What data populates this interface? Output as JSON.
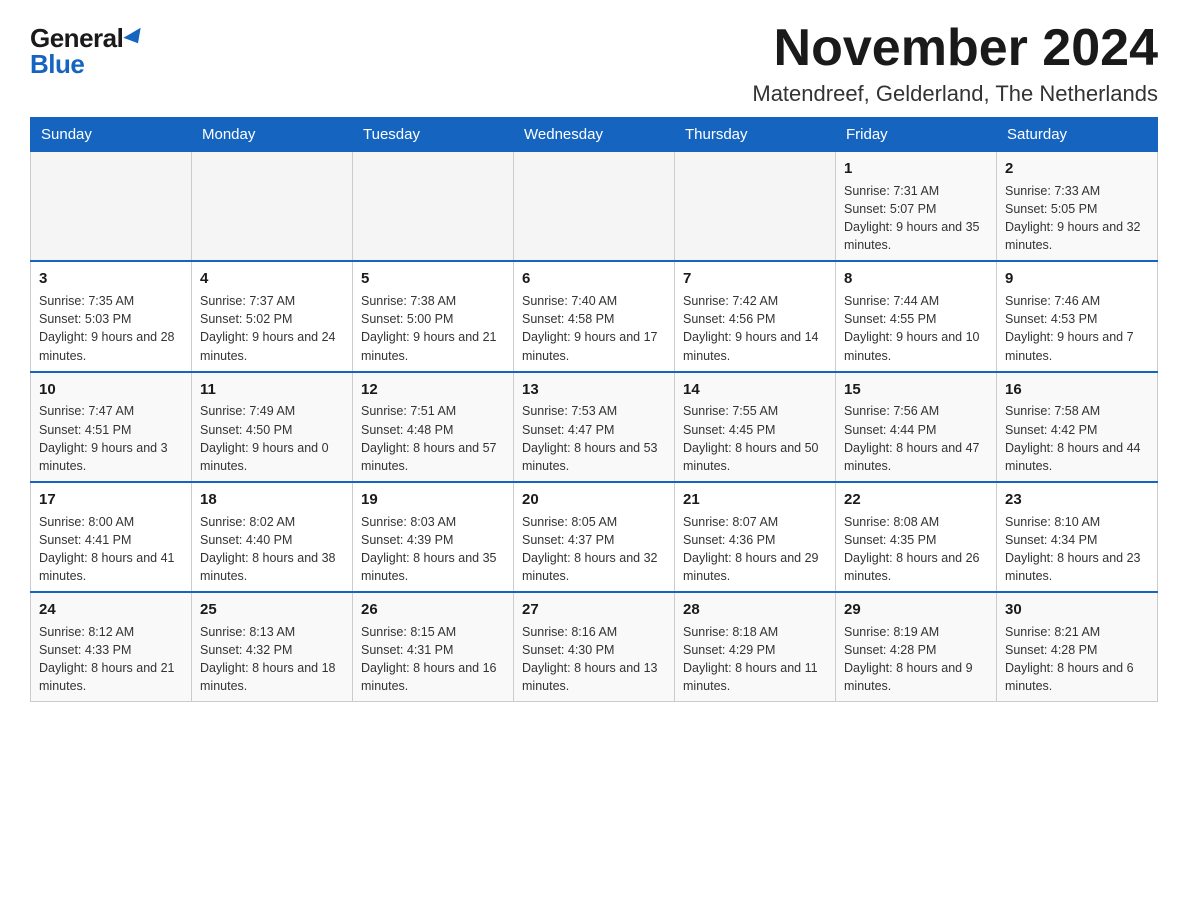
{
  "logo": {
    "general": "General",
    "blue": "Blue",
    "triangle": "▶"
  },
  "title": {
    "month_year": "November 2024",
    "location": "Matendreef, Gelderland, The Netherlands"
  },
  "headers": [
    "Sunday",
    "Monday",
    "Tuesday",
    "Wednesday",
    "Thursday",
    "Friday",
    "Saturday"
  ],
  "weeks": [
    [
      {
        "day": "",
        "info": ""
      },
      {
        "day": "",
        "info": ""
      },
      {
        "day": "",
        "info": ""
      },
      {
        "day": "",
        "info": ""
      },
      {
        "day": "",
        "info": ""
      },
      {
        "day": "1",
        "info": "Sunrise: 7:31 AM\nSunset: 5:07 PM\nDaylight: 9 hours and 35 minutes."
      },
      {
        "day": "2",
        "info": "Sunrise: 7:33 AM\nSunset: 5:05 PM\nDaylight: 9 hours and 32 minutes."
      }
    ],
    [
      {
        "day": "3",
        "info": "Sunrise: 7:35 AM\nSunset: 5:03 PM\nDaylight: 9 hours and 28 minutes."
      },
      {
        "day": "4",
        "info": "Sunrise: 7:37 AM\nSunset: 5:02 PM\nDaylight: 9 hours and 24 minutes."
      },
      {
        "day": "5",
        "info": "Sunrise: 7:38 AM\nSunset: 5:00 PM\nDaylight: 9 hours and 21 minutes."
      },
      {
        "day": "6",
        "info": "Sunrise: 7:40 AM\nSunset: 4:58 PM\nDaylight: 9 hours and 17 minutes."
      },
      {
        "day": "7",
        "info": "Sunrise: 7:42 AM\nSunset: 4:56 PM\nDaylight: 9 hours and 14 minutes."
      },
      {
        "day": "8",
        "info": "Sunrise: 7:44 AM\nSunset: 4:55 PM\nDaylight: 9 hours and 10 minutes."
      },
      {
        "day": "9",
        "info": "Sunrise: 7:46 AM\nSunset: 4:53 PM\nDaylight: 9 hours and 7 minutes."
      }
    ],
    [
      {
        "day": "10",
        "info": "Sunrise: 7:47 AM\nSunset: 4:51 PM\nDaylight: 9 hours and 3 minutes."
      },
      {
        "day": "11",
        "info": "Sunrise: 7:49 AM\nSunset: 4:50 PM\nDaylight: 9 hours and 0 minutes."
      },
      {
        "day": "12",
        "info": "Sunrise: 7:51 AM\nSunset: 4:48 PM\nDaylight: 8 hours and 57 minutes."
      },
      {
        "day": "13",
        "info": "Sunrise: 7:53 AM\nSunset: 4:47 PM\nDaylight: 8 hours and 53 minutes."
      },
      {
        "day": "14",
        "info": "Sunrise: 7:55 AM\nSunset: 4:45 PM\nDaylight: 8 hours and 50 minutes."
      },
      {
        "day": "15",
        "info": "Sunrise: 7:56 AM\nSunset: 4:44 PM\nDaylight: 8 hours and 47 minutes."
      },
      {
        "day": "16",
        "info": "Sunrise: 7:58 AM\nSunset: 4:42 PM\nDaylight: 8 hours and 44 minutes."
      }
    ],
    [
      {
        "day": "17",
        "info": "Sunrise: 8:00 AM\nSunset: 4:41 PM\nDaylight: 8 hours and 41 minutes."
      },
      {
        "day": "18",
        "info": "Sunrise: 8:02 AM\nSunset: 4:40 PM\nDaylight: 8 hours and 38 minutes."
      },
      {
        "day": "19",
        "info": "Sunrise: 8:03 AM\nSunset: 4:39 PM\nDaylight: 8 hours and 35 minutes."
      },
      {
        "day": "20",
        "info": "Sunrise: 8:05 AM\nSunset: 4:37 PM\nDaylight: 8 hours and 32 minutes."
      },
      {
        "day": "21",
        "info": "Sunrise: 8:07 AM\nSunset: 4:36 PM\nDaylight: 8 hours and 29 minutes."
      },
      {
        "day": "22",
        "info": "Sunrise: 8:08 AM\nSunset: 4:35 PM\nDaylight: 8 hours and 26 minutes."
      },
      {
        "day": "23",
        "info": "Sunrise: 8:10 AM\nSunset: 4:34 PM\nDaylight: 8 hours and 23 minutes."
      }
    ],
    [
      {
        "day": "24",
        "info": "Sunrise: 8:12 AM\nSunset: 4:33 PM\nDaylight: 8 hours and 21 minutes."
      },
      {
        "day": "25",
        "info": "Sunrise: 8:13 AM\nSunset: 4:32 PM\nDaylight: 8 hours and 18 minutes."
      },
      {
        "day": "26",
        "info": "Sunrise: 8:15 AM\nSunset: 4:31 PM\nDaylight: 8 hours and 16 minutes."
      },
      {
        "day": "27",
        "info": "Sunrise: 8:16 AM\nSunset: 4:30 PM\nDaylight: 8 hours and 13 minutes."
      },
      {
        "day": "28",
        "info": "Sunrise: 8:18 AM\nSunset: 4:29 PM\nDaylight: 8 hours and 11 minutes."
      },
      {
        "day": "29",
        "info": "Sunrise: 8:19 AM\nSunset: 4:28 PM\nDaylight: 8 hours and 9 minutes."
      },
      {
        "day": "30",
        "info": "Sunrise: 8:21 AM\nSunset: 4:28 PM\nDaylight: 8 hours and 6 minutes."
      }
    ]
  ]
}
